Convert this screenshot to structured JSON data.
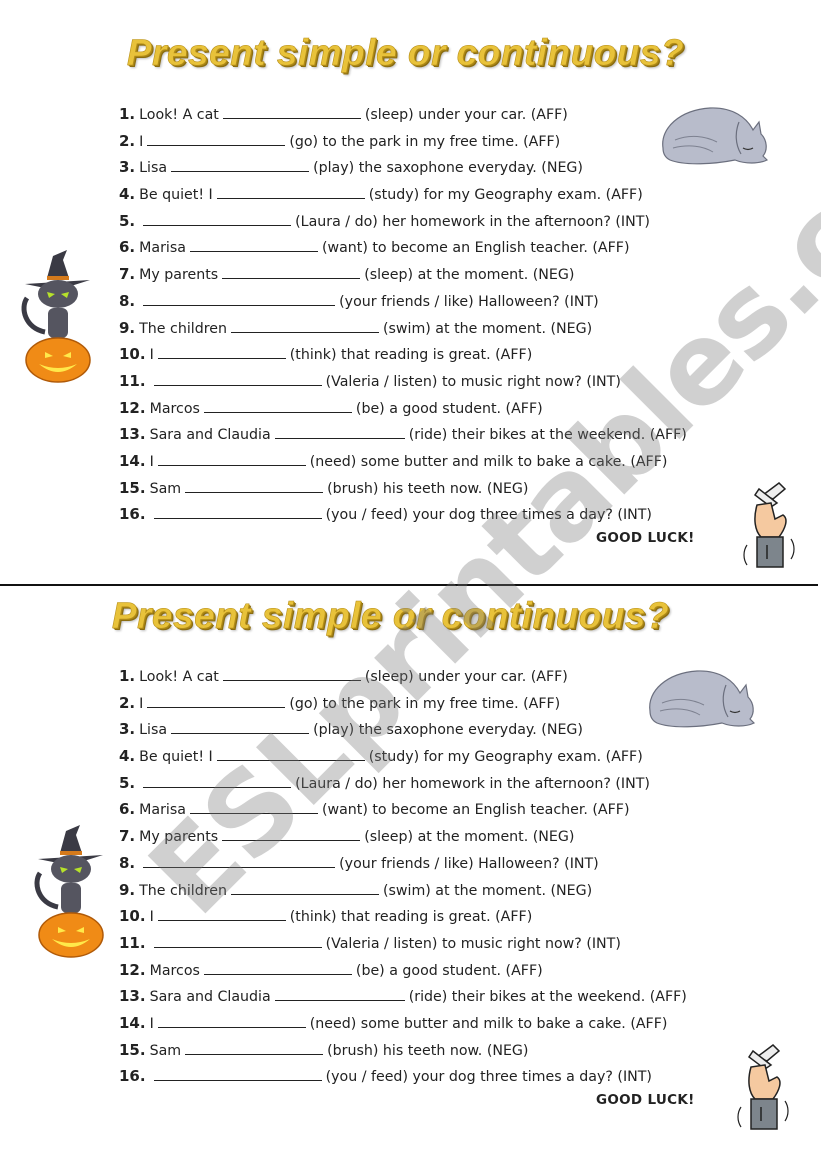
{
  "worksheet": {
    "title": "Present simple or continuous?",
    "good_luck": "GOOD LUCK!",
    "watermark": "ESLprintables.com",
    "items": [
      {
        "num": "1.",
        "before": "Look! A cat",
        "blank": 138,
        "after": "(sleep) under your car. (AFF)"
      },
      {
        "num": "2.",
        "before": "I",
        "blank": 138,
        "after": "(go) to the park in my free time. (AFF)"
      },
      {
        "num": "3.",
        "before": "Lisa",
        "blank": 138,
        "after": "(play) the saxophone everyday. (NEG)"
      },
      {
        "num": "4.",
        "before": "Be quiet! I",
        "blank": 148,
        "after": "(study) for my Geography exam. (AFF)"
      },
      {
        "num": "5.",
        "before": "",
        "blank": 148,
        "after": "(Laura / do) her homework in the afternoon? (INT)"
      },
      {
        "num": "6.",
        "before": "Marisa",
        "blank": 128,
        "after": "(want) to become an English teacher. (AFF)"
      },
      {
        "num": "7.",
        "before": "My parents",
        "blank": 138,
        "after": "(sleep) at the moment. (NEG)"
      },
      {
        "num": "8.",
        "before": "",
        "blank": 192,
        "after": "(your friends / like) Halloween? (INT)"
      },
      {
        "num": "9.",
        "before": "The children",
        "blank": 148,
        "after": "(swim) at the moment. (NEG)"
      },
      {
        "num": "10.",
        "before": "I",
        "blank": 128,
        "after": "(think) that reading is great. (AFF)"
      },
      {
        "num": "11.",
        "before": "",
        "blank": 168,
        "after": "(Valeria / listen) to music right now? (INT)"
      },
      {
        "num": "12.",
        "before": "Marcos",
        "blank": 148,
        "after": "(be) a good student. (AFF)"
      },
      {
        "num": "13.",
        "before": "Sara and Claudia",
        "blank": 130,
        "after": "(ride) their bikes at the weekend. (AFF)"
      },
      {
        "num": "14.",
        "before": "I",
        "blank": 148,
        "after": "(need) some butter and milk to bake a cake. (AFF)"
      },
      {
        "num": "15.",
        "before": "Sam",
        "blank": 138,
        "after": "(brush) his teeth now. (NEG)"
      },
      {
        "num": "16.",
        "before": "",
        "blank": 168,
        "after": "(you / feed) your dog three times a day? (INT)"
      }
    ],
    "icons": {
      "sleeping_cat": "sleeping-cat-illustration",
      "halloween_cat": "halloween-cat-on-pumpkin-illustration",
      "crossed_fingers": "crossed-fingers-hand-illustration"
    },
    "colors": {
      "title_gold": "#e8c23a",
      "title_shadow": "#8a6c10",
      "text": "#222222",
      "watermark": "#787878"
    }
  }
}
